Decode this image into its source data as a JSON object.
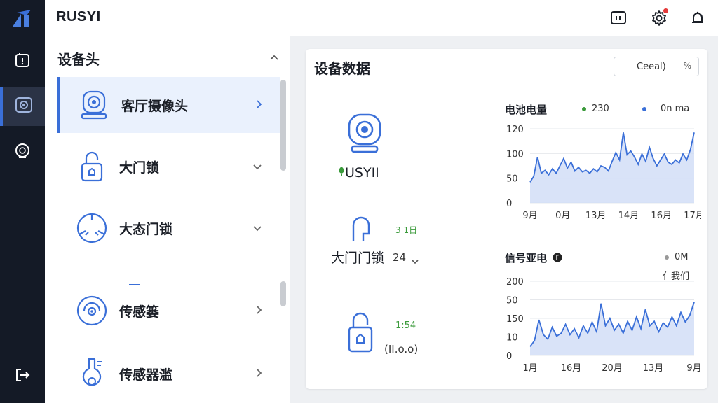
{
  "app": {
    "title": "RUSYI"
  },
  "rail": {
    "items": [
      "alert-icon",
      "camera-icon",
      "devices-icon"
    ],
    "logout": "logout-icon"
  },
  "header": {
    "icons": [
      "monitor-icon",
      "gear-icon",
      "bell-icon"
    ],
    "accent": "#3a6fd8",
    "notify_color": "#e53b3b"
  },
  "list": {
    "heading": "设备头",
    "items": [
      {
        "label": "客厅摄像头",
        "icon": "camera-icon",
        "chevron": "chevron-right-icon",
        "selected": true
      },
      {
        "label": "大门锁",
        "icon": "lock-icon",
        "chevron": "chevron-down-icon"
      },
      {
        "label": "大态门锁",
        "icon": "sensor-icon",
        "chevron": "chevron-down-icon"
      },
      {
        "label": "传感篓",
        "icon": "target-icon",
        "chevron": "chevron-right-icon"
      },
      {
        "label": "传感器滥",
        "icon": "flask-icon",
        "chevron": "chevron-right-icon"
      }
    ]
  },
  "panel": {
    "title": "设备数据",
    "search_value": "Ceeal)",
    "search_suffix": "%",
    "device1": {
      "name": "USYII"
    },
    "device2": {
      "name": "大门门锁",
      "suffix": "24",
      "tag": "3 1日"
    },
    "device3": {
      "value_top": "1:54",
      "value_bottom": "(II.o.o)"
    }
  },
  "chart_data": [
    {
      "type": "area",
      "title": "电池电量",
      "legend": [
        {
          "label": "230",
          "color": "#3a9a3a"
        },
        {
          "label": "0n ma",
          "color": "#3a6fd8"
        }
      ],
      "x": [
        "9月",
        "0月",
        "13月",
        "14月",
        "16月",
        "17月"
      ],
      "yticks": [
        "120",
        "100",
        "50",
        "0"
      ],
      "values": [
        28,
        36,
        62,
        40,
        44,
        38,
        46,
        40,
        50,
        60,
        47,
        55,
        43,
        48,
        42,
        44,
        40,
        46,
        42,
        50,
        48,
        43,
        56,
        68,
        58,
        95,
        65,
        70,
        62,
        52,
        66,
        56,
        75,
        60,
        50,
        58,
        66,
        55,
        52,
        58,
        54,
        66,
        58,
        72,
        95
      ]
    },
    {
      "type": "area",
      "title": "信号亚电",
      "legend": [
        {
          "label": "0M",
          "color": "#999999"
        }
      ],
      "sublabel": "亻我们",
      "x": [
        "1月",
        "16月",
        "20月",
        "13月",
        "9月"
      ],
      "yticks": [
        "200",
        "50",
        "150",
        "10",
        "0"
      ],
      "values": [
        12,
        20,
        48,
        28,
        22,
        38,
        26,
        30,
        42,
        28,
        36,
        24,
        40,
        30,
        45,
        32,
        70,
        40,
        50,
        34,
        42,
        30,
        46,
        34,
        52,
        36,
        62,
        40,
        46,
        32,
        44,
        38,
        52,
        40,
        58,
        45,
        54,
        72
      ]
    }
  ]
}
